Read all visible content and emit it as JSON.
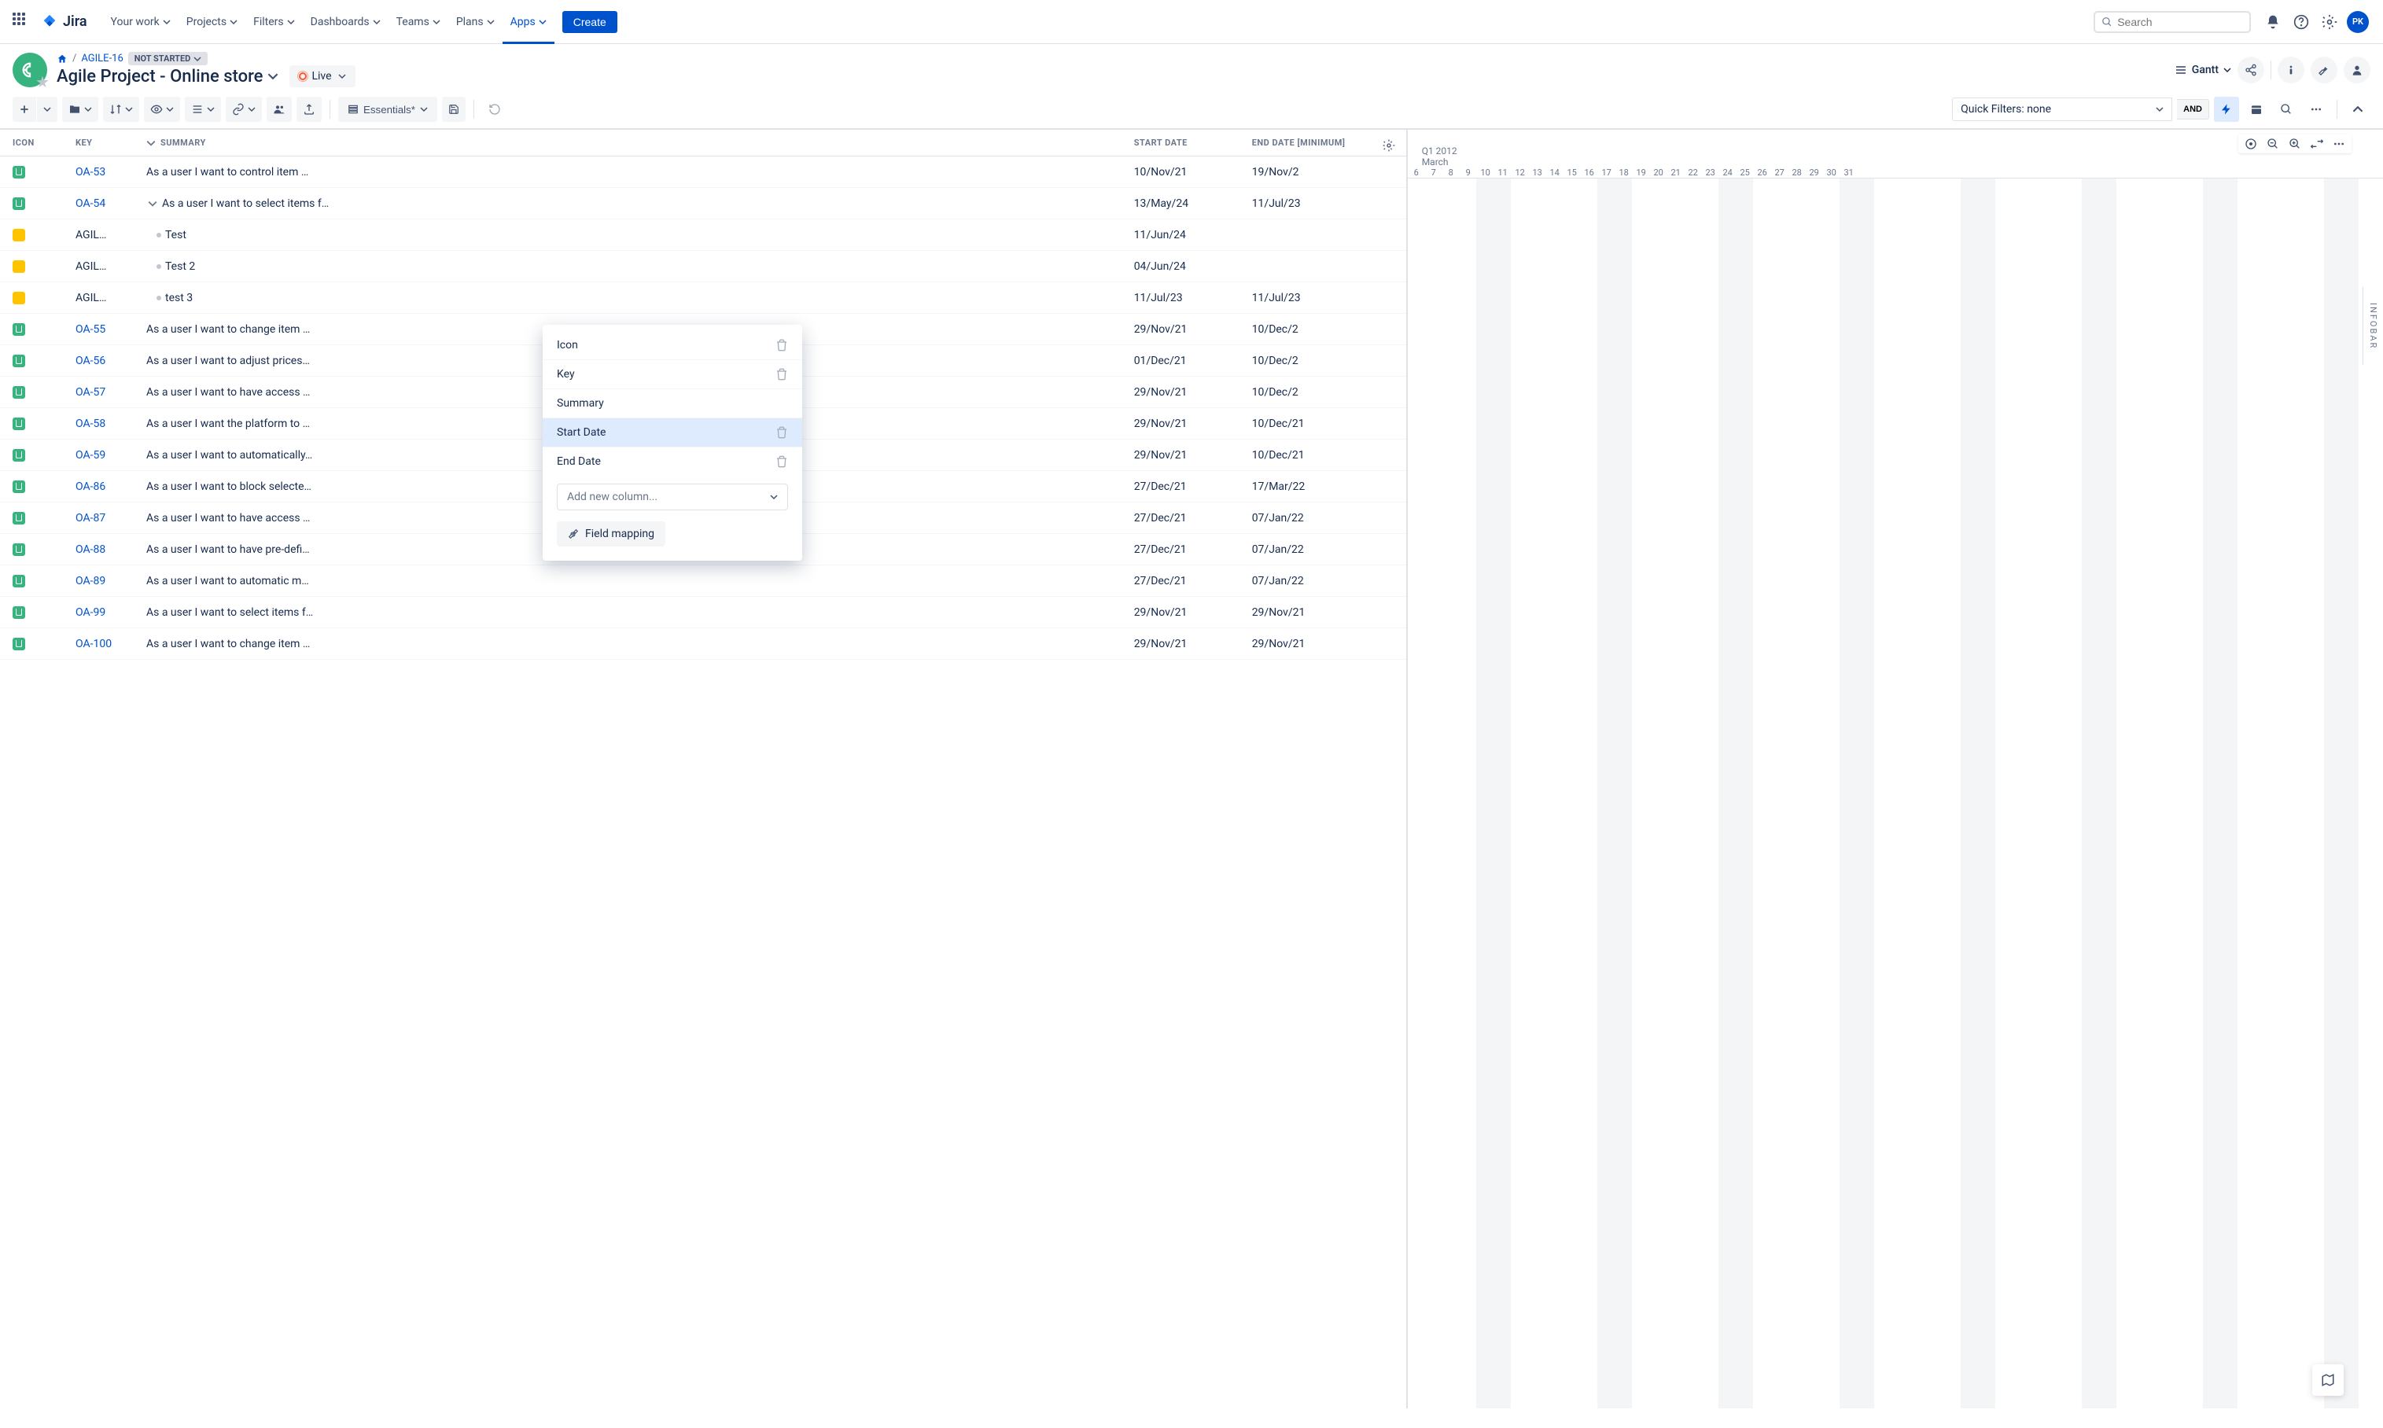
{
  "nav": {
    "product": "Jira",
    "items": [
      "Your work",
      "Projects",
      "Filters",
      "Dashboards",
      "Teams",
      "Plans",
      "Apps"
    ],
    "active_index": 6,
    "create_label": "Create",
    "search_placeholder": "Search",
    "avatar_initials": "PK"
  },
  "header": {
    "breadcrumb_agile": "AGILE-16",
    "status": "NOT STARTED",
    "project_title": "Agile Project - Online store",
    "live_label": "Live",
    "view_label": "Gantt"
  },
  "toolbar": {
    "config_label": "Essentials*",
    "quick_filters_label": "Quick Filters: none",
    "and_label": "AND"
  },
  "columns": {
    "icon": "ICON",
    "key": "KEY",
    "summary": "SUMMARY",
    "start": "START DATE",
    "end": "END DATE [MINIMUM]"
  },
  "popover": {
    "items": [
      {
        "label": "Icon",
        "deletable": true
      },
      {
        "label": "Key",
        "deletable": true
      },
      {
        "label": "Summary",
        "deletable": false
      },
      {
        "label": "Start Date",
        "deletable": true,
        "highlighted": true
      },
      {
        "label": "End Date",
        "deletable": true
      }
    ],
    "add_placeholder": "Add new column...",
    "field_mapping": "Field mapping"
  },
  "gantt": {
    "quarter": "Q1 2012",
    "month": "March",
    "days": [
      "6",
      "7",
      "8",
      "9",
      "10",
      "11",
      "12",
      "13",
      "14",
      "15",
      "16",
      "17",
      "18",
      "19",
      "20",
      "21",
      "22",
      "23",
      "24",
      "25",
      "26",
      "27",
      "28",
      "29",
      "30",
      "31"
    ]
  },
  "infobar_label": "INFOBAR",
  "rows": [
    {
      "icon": "story",
      "key": "OA-53",
      "key_link": true,
      "indent": 0,
      "toggle": false,
      "summary": "As a user I want to control item …",
      "start": "10/Nov/21",
      "end": "19/Nov/2"
    },
    {
      "icon": "story",
      "key": "OA-54",
      "key_link": true,
      "indent": 0,
      "toggle": true,
      "summary": "As a user I want to select items f…",
      "start": "13/May/24",
      "end": "11/Jul/23"
    },
    {
      "icon": "task",
      "key": "AGIL…",
      "key_link": false,
      "indent": 1,
      "toggle": false,
      "summary": "Test",
      "start": "11/Jun/24",
      "end": ""
    },
    {
      "icon": "task",
      "key": "AGIL…",
      "key_link": false,
      "indent": 1,
      "toggle": false,
      "summary": "Test 2",
      "start": "04/Jun/24",
      "end": ""
    },
    {
      "icon": "task",
      "key": "AGIL…",
      "key_link": false,
      "indent": 1,
      "toggle": false,
      "summary": "test 3",
      "start": "11/Jul/23",
      "end": "11/Jul/23"
    },
    {
      "icon": "story",
      "key": "OA-55",
      "key_link": true,
      "indent": 0,
      "toggle": false,
      "summary": "As a user I want to change item …",
      "start": "29/Nov/21",
      "end": "10/Dec/2"
    },
    {
      "icon": "story",
      "key": "OA-56",
      "key_link": true,
      "indent": 0,
      "toggle": false,
      "summary": "As a user I want to adjust prices…",
      "start": "01/Dec/21",
      "end": "10/Dec/2"
    },
    {
      "icon": "story",
      "key": "OA-57",
      "key_link": true,
      "indent": 0,
      "toggle": false,
      "summary": "As a user I want to have access …",
      "start": "29/Nov/21",
      "end": "10/Dec/2"
    },
    {
      "icon": "story",
      "key": "OA-58",
      "key_link": true,
      "indent": 0,
      "toggle": false,
      "summary": "As a user I want the platform to …",
      "start": "29/Nov/21",
      "end": "10/Dec/21"
    },
    {
      "icon": "story",
      "key": "OA-59",
      "key_link": true,
      "indent": 0,
      "toggle": false,
      "summary": "As a user I want to automatically…",
      "start": "29/Nov/21",
      "end": "10/Dec/21"
    },
    {
      "icon": "story",
      "key": "OA-86",
      "key_link": true,
      "indent": 0,
      "toggle": false,
      "summary": "As a user I want to block selecte…",
      "start": "27/Dec/21",
      "end": "17/Mar/22"
    },
    {
      "icon": "story",
      "key": "OA-87",
      "key_link": true,
      "indent": 0,
      "toggle": false,
      "summary": "As a user I want to have access …",
      "start": "27/Dec/21",
      "end": "07/Jan/22"
    },
    {
      "icon": "story",
      "key": "OA-88",
      "key_link": true,
      "indent": 0,
      "toggle": false,
      "summary": "As a user I want to have pre-defi…",
      "start": "27/Dec/21",
      "end": "07/Jan/22"
    },
    {
      "icon": "story",
      "key": "OA-89",
      "key_link": true,
      "indent": 0,
      "toggle": false,
      "summary": "As a user I want to automatic m…",
      "start": "27/Dec/21",
      "end": "07/Jan/22"
    },
    {
      "icon": "story",
      "key": "OA-99",
      "key_link": true,
      "indent": 0,
      "toggle": false,
      "summary": "As a user I want to select items f…",
      "start": "29/Nov/21",
      "end": "29/Nov/21"
    },
    {
      "icon": "story",
      "key": "OA-100",
      "key_link": true,
      "indent": 0,
      "toggle": false,
      "summary": "As a user I want to change item …",
      "start": "29/Nov/21",
      "end": "29/Nov/21"
    }
  ]
}
